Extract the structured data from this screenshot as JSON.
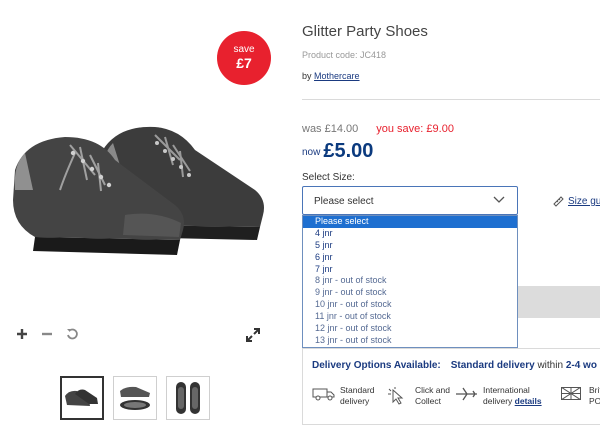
{
  "badge": {
    "line1": "save",
    "line2": "£7"
  },
  "gallery": {
    "zoom_in": "+",
    "zoom_out": "−"
  },
  "product": {
    "title": "Glitter Party Shoes",
    "code": "Product code: JC418",
    "by_prefix": "by",
    "brand": "Mothercare"
  },
  "pricing": {
    "was_label": "was £14.00",
    "you_save": "you save: £9.00",
    "now_label": "now",
    "now_price": "£5.00"
  },
  "size": {
    "label": "Select Size:",
    "selected": "Please select",
    "guide": "Size gu",
    "options": [
      "Please select",
      "4 jnr",
      "5 jnr",
      "6 jnr",
      "7 jnr",
      "8 jnr - out of stock",
      "9 jnr - out of stock",
      "10 jnr - out of stock",
      "11 jnr - out of stock",
      "12 jnr - out of stock",
      "13 jnr - out of stock"
    ]
  },
  "delivery": {
    "heading": "Delivery Options Available:",
    "standard": "Standard delivery",
    "within": "within",
    "days": "2-4 wo",
    "options": [
      {
        "line1": "Standard",
        "line2": "delivery"
      },
      {
        "line1": "Click and",
        "line2": "Collect"
      },
      {
        "line1": "International",
        "line2_prefix": "delivery",
        "link": "details"
      },
      {
        "line1": "Briti",
        "line2": "PO a"
      }
    ]
  },
  "colors": {
    "accent_red": "#e8212e",
    "brand_blue": "#0b3a7e",
    "select_highlight": "#1e6fd0"
  }
}
